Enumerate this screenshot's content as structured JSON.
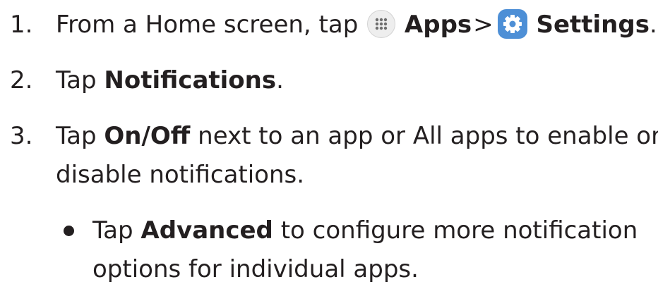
{
  "steps": [
    {
      "number": "1.",
      "lead": "From a Home screen, tap",
      "apps_label": "Apps",
      "separator": ">",
      "settings_label": "Settings",
      "period": ".",
      "apps_icon": "apps-grid-icon",
      "settings_icon": "settings-gear-icon"
    },
    {
      "number": "2.",
      "lead": "Tap",
      "bold": "Notifications",
      "tail": "."
    },
    {
      "number": "3.",
      "lead": "Tap",
      "bold": "On/Off",
      "tail": "next to an app or All apps to enable or",
      "line2": "disable notifications."
    }
  ],
  "sub_bullet": {
    "lead": "Tap",
    "bold": "Advanced",
    "tail": "to configure more notification",
    "line2": "options for individual apps."
  },
  "colors": {
    "text": "#231f20",
    "settings_icon_bg": "#4d8fd6",
    "apps_icon_bg": "#eeeeee"
  }
}
